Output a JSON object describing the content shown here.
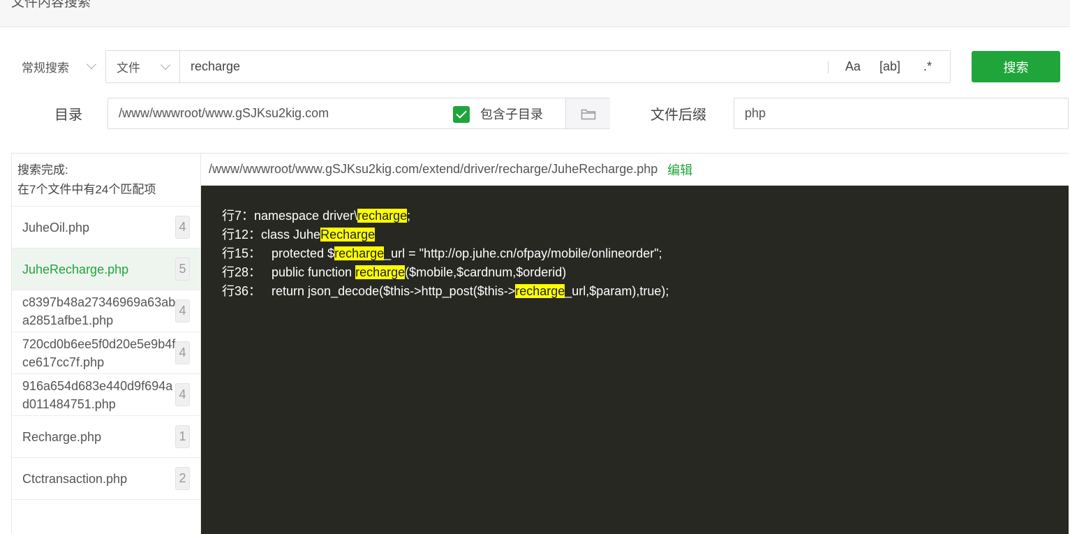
{
  "header": {
    "title": "文件内容搜索"
  },
  "search": {
    "mode": "常规搜索",
    "type": "文件",
    "query": "recharge",
    "options": {
      "case": "Aa",
      "word": "[ab]",
      "regex": ".*"
    },
    "button": "搜索"
  },
  "directory": {
    "label": "目录",
    "path": "/www/wwwroot/www.gSJKsu2kig.com",
    "include_sub_label": "包含子目录",
    "include_sub_checked": true,
    "suffix_label": "文件后缀",
    "suffix": "php"
  },
  "summary": {
    "line1": "搜索完成:",
    "line2": "在7个文件中有24个匹配项"
  },
  "files": [
    {
      "name": "JuheOil.php",
      "count": "4",
      "active": false
    },
    {
      "name": "JuheRecharge.php",
      "count": "5",
      "active": true
    },
    {
      "name": "c8397b48a27346969a63aba2851afbe1.php",
      "count": "4",
      "active": false
    },
    {
      "name": "720cd0b6ee5f0d20e5e9b4fce617cc7f.php",
      "count": "4",
      "active": false
    },
    {
      "name": "916a654d683e440d9f694ad011484751.php",
      "count": "4",
      "active": false
    },
    {
      "name": "Recharge.php",
      "count": "1",
      "active": false
    },
    {
      "name": "Ctctransaction.php",
      "count": "2",
      "active": false
    }
  ],
  "content": {
    "path": "/www/wwwroot/www.gSJKsu2kig.com/extend/driver/recharge/JuheRecharge.php",
    "edit_label": "编辑",
    "lines": [
      {
        "prefix": "行7：namespace driver\\",
        "match": "recharge",
        "suffix": ";"
      },
      {
        "prefix": "行12：class Juhe",
        "match": "Recharge",
        "suffix": ""
      },
      {
        "prefix": "行15：   protected $",
        "match": "recharge",
        "suffix": "_url = \"http://op.juhe.cn/ofpay/mobile/onlineorder\";"
      },
      {
        "prefix": "行28：   public function ",
        "match": "recharge",
        "suffix": "($mobile,$cardnum,$orderid)"
      },
      {
        "prefix": "行36：   return json_decode($this->http_post($this->",
        "match": "recharge",
        "suffix": "_url,$param),true);"
      }
    ]
  },
  "colors": {
    "accent": "#20a53a",
    "highlight": "#ffff00",
    "code_bg": "#272822"
  },
  "icons": {
    "mode_dropdown": "chevron-down-icon",
    "type_dropdown": "chevron-down-icon",
    "folder": "folder-icon",
    "checkbox": "check-icon"
  }
}
